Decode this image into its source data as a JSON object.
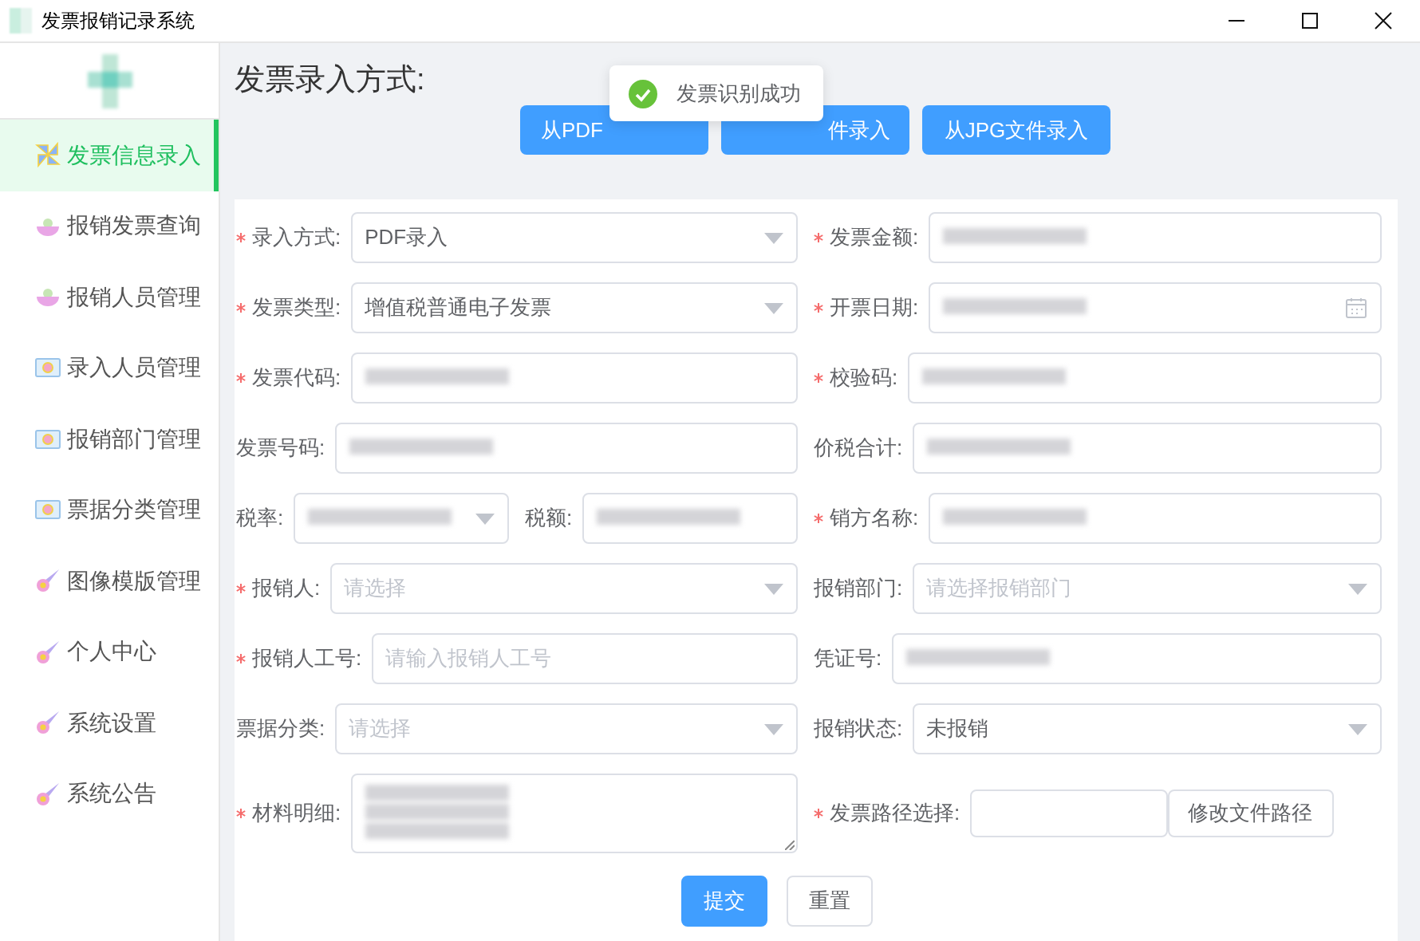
{
  "window": {
    "title": "发票报销记录系统"
  },
  "sidebar": {
    "items": [
      {
        "label": "发票信息录入",
        "selected": true
      },
      {
        "label": "报销发票查询",
        "selected": false
      },
      {
        "label": "报销人员管理",
        "selected": false
      },
      {
        "label": "录入人员管理",
        "selected": false
      },
      {
        "label": "报销部门管理",
        "selected": false
      },
      {
        "label": "票据分类管理",
        "selected": false
      },
      {
        "label": "图像模版管理",
        "selected": false
      },
      {
        "label": "个人中心",
        "selected": false
      },
      {
        "label": "系统设置",
        "selected": false
      },
      {
        "label": "系统公告",
        "selected": false
      }
    ]
  },
  "heading": "发票录入方式:",
  "entry_buttons": [
    "从PDF",
    "件录入",
    "从JPG文件录入"
  ],
  "toast": {
    "text": "发票识别成功"
  },
  "form": {
    "rows": [
      [
        {
          "kind": "select",
          "label": "录入方式:",
          "required": true,
          "value": "PDF录入"
        },
        {
          "kind": "input",
          "label": "发票金额:",
          "required": true,
          "masked": true
        }
      ],
      [
        {
          "kind": "select",
          "label": "发票类型:",
          "required": true,
          "value": "增值税普通电子发票"
        },
        {
          "kind": "date",
          "label": "开票日期:",
          "required": true,
          "masked": true
        }
      ],
      [
        {
          "kind": "input",
          "label": "发票代码:",
          "required": true,
          "masked": true
        },
        {
          "kind": "input",
          "label": "校验码:",
          "required": true,
          "masked": true
        }
      ],
      [
        {
          "kind": "input",
          "label": "发票号码:",
          "required": false,
          "masked": true
        },
        {
          "kind": "input",
          "label": "价税合计:",
          "required": false,
          "masked": true
        }
      ],
      [
        {
          "kind": "select",
          "label": "税率:",
          "required": false,
          "masked": true
        },
        {
          "kind": "input",
          "label": "税额:",
          "required": false,
          "masked": true
        },
        {
          "kind": "input",
          "label": "销方名称:",
          "required": true,
          "masked": true
        }
      ],
      [
        {
          "kind": "select",
          "label": "报销人:",
          "required": true,
          "placeholder": "请选择"
        },
        {
          "kind": "select",
          "label": "报销部门:",
          "required": false,
          "placeholder": "请选择报销部门"
        }
      ],
      [
        {
          "kind": "input",
          "label": "报销人工号:",
          "required": true,
          "placeholder": "请输入报销人工号"
        },
        {
          "kind": "input",
          "label": "凭证号:",
          "required": false,
          "masked": true
        }
      ],
      [
        {
          "kind": "select",
          "label": "票据分类:",
          "required": false,
          "placeholder": "请选择"
        },
        {
          "kind": "select",
          "label": "报销状态:",
          "required": false,
          "value": "未报销"
        }
      ],
      [
        {
          "kind": "textarea",
          "label": "材料明细:",
          "required": true,
          "masked": true
        },
        {
          "kind": "path",
          "label": "发票路径选择:",
          "required": true,
          "button": "修改文件路径"
        }
      ]
    ],
    "actions": [
      {
        "label": "提交",
        "kind": "primary"
      },
      {
        "label": "重置",
        "kind": "default"
      }
    ]
  }
}
